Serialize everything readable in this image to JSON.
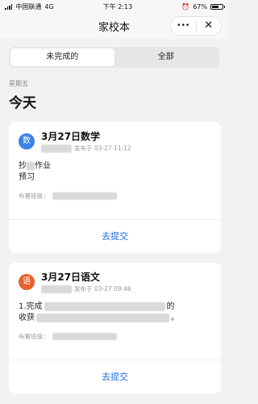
{
  "status_bar": {
    "carrier": "中国联通",
    "network": "4G",
    "time": "下午 2:13",
    "battery": "67%",
    "battery_level": 0.67
  },
  "nav": {
    "title": "家校本",
    "more": "•••",
    "close": "✕"
  },
  "tabs": [
    {
      "label": "未完成的",
      "active": true
    },
    {
      "label": "全部",
      "active": false
    }
  ],
  "day": {
    "weekday": "星期五",
    "heading": "今天"
  },
  "homework": [
    {
      "badge": "数",
      "badge_color": "#3b82e6",
      "title": "3月27日数学",
      "published": "发布于 03-27 11:12",
      "content": [
        "抄",
        "作业",
        "预",
        "习"
      ],
      "class_label": "布置班级：",
      "action": "去提交"
    },
    {
      "badge": "语",
      "badge_color": "#e8602c",
      "title": "3月27日语文",
      "published": "发布于 03-27 09:46",
      "content": [
        "1.完成",
        "的",
        "收获",
        "。"
      ],
      "class_label": "布置班级：",
      "action": "去提交"
    }
  ]
}
